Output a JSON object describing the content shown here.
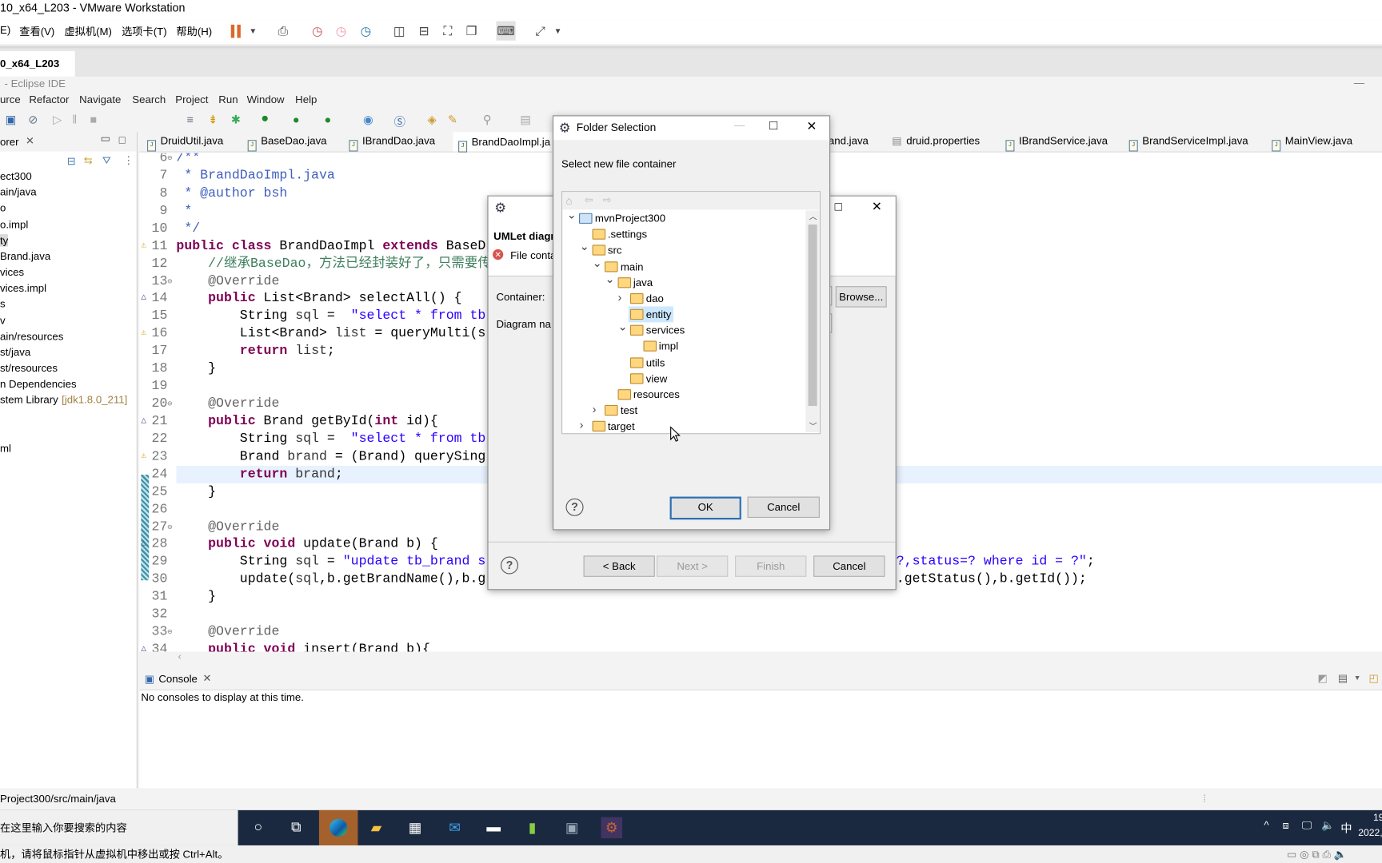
{
  "vmware": {
    "title": "10_x64_L203 - VMware Workstation",
    "menu": [
      "E)",
      "查看(V)",
      "虚拟机(M)",
      "选项卡(T)",
      "帮助(H)"
    ],
    "tab": "0_x64_L203",
    "status": "机，请将鼠标指针从虚拟机中移出或按 Ctrl+Alt。",
    "accent": "#d9692b"
  },
  "eclipse": {
    "title": "- Eclipse IDE",
    "menu": [
      "urce",
      "Refactor",
      "Navigate",
      "Search",
      "Project",
      "Run",
      "Window",
      "Help"
    ],
    "explorer": {
      "title": "orer",
      "items": [
        "ect300",
        "ain/java",
        "o",
        "o.impl",
        "ty",
        "Brand.java",
        "vices",
        "vices.impl",
        "s",
        "v",
        "ain/resources",
        "st/java",
        "st/resources",
        "n Dependencies",
        "stem Library",
        "ml"
      ],
      "jre_suffix": "[jdk1.8.0_211]",
      "selected": "ty"
    },
    "editor_tabs": [
      "DruidUtil.java",
      "BaseDao.java",
      "IBrandDao.java",
      "BrandDaoImpl.ja",
      "and.java",
      "druid.properties",
      "IBrandService.java",
      "BrandServiceImpl.java",
      "MainView.java"
    ],
    "active_tab": "BrandDaoImpl.ja",
    "code": [
      {
        "n": "6",
        "t": [
          [
            "c",
            "/**"
          ]
        ]
      },
      {
        "n": "7",
        "t": [
          [
            "c",
            " * BrandDaoImpl.java"
          ]
        ]
      },
      {
        "n": "8",
        "t": [
          [
            "c",
            " * "
          ],
          [
            "c",
            "@author"
          ],
          [
            "c",
            " bsh"
          ]
        ]
      },
      {
        "n": "9",
        "t": [
          [
            "c",
            " *"
          ]
        ]
      },
      {
        "n": "10",
        "t": [
          [
            "c",
            " */"
          ]
        ]
      },
      {
        "n": "11",
        "t": [
          [
            "k",
            "public"
          ],
          [
            "p",
            " "
          ],
          [
            "k",
            "class"
          ],
          [
            "p",
            " BrandDaoImpl "
          ],
          [
            "k",
            "extends"
          ],
          [
            "p",
            " BaseD"
          ]
        ]
      },
      {
        "n": "12",
        "t": [
          [
            "p",
            "    "
          ],
          [
            "cg",
            "//继承BaseDao，方法已经封装好了，只需要传入s"
          ]
        ]
      },
      {
        "n": "13",
        "t": [
          [
            "p",
            "    "
          ],
          [
            "an",
            "@Override"
          ]
        ]
      },
      {
        "n": "14",
        "t": [
          [
            "p",
            "    "
          ],
          [
            "k",
            "public"
          ],
          [
            "p",
            " List<Brand> selectAll() {"
          ]
        ]
      },
      {
        "n": "15",
        "t": [
          [
            "p",
            "        String "
          ],
          [
            "v",
            "sql"
          ],
          [
            "p",
            " =  "
          ],
          [
            "s",
            "\"select * from tb"
          ]
        ]
      },
      {
        "n": "16",
        "t": [
          [
            "p",
            "        List<Brand> "
          ],
          [
            "v",
            "list"
          ],
          [
            "p",
            " = queryMulti(s"
          ]
        ]
      },
      {
        "n": "17",
        "t": [
          [
            "p",
            "        "
          ],
          [
            "k",
            "return"
          ],
          [
            "p",
            " "
          ],
          [
            "v",
            "list"
          ],
          [
            "p",
            ";"
          ]
        ]
      },
      {
        "n": "18",
        "t": [
          [
            "p",
            "    }"
          ]
        ]
      },
      {
        "n": "19",
        "t": []
      },
      {
        "n": "20",
        "t": [
          [
            "p",
            "    "
          ],
          [
            "an",
            "@Override"
          ]
        ]
      },
      {
        "n": "21",
        "t": [
          [
            "p",
            "    "
          ],
          [
            "k",
            "public"
          ],
          [
            "p",
            " Brand getById("
          ],
          [
            "k",
            "int"
          ],
          [
            "p",
            " id){"
          ]
        ]
      },
      {
        "n": "22",
        "t": [
          [
            "p",
            "        String "
          ],
          [
            "v",
            "sql"
          ],
          [
            "p",
            " =  "
          ],
          [
            "s",
            "\"select * from tb"
          ]
        ]
      },
      {
        "n": "23",
        "t": [
          [
            "p",
            "        Brand "
          ],
          [
            "v",
            "brand"
          ],
          [
            "p",
            " = (Brand) querySing"
          ]
        ]
      },
      {
        "n": "24",
        "t": [
          [
            "p",
            "        "
          ],
          [
            "k",
            "return"
          ],
          [
            "p",
            " "
          ],
          [
            "v",
            "brand"
          ],
          [
            "p",
            ";"
          ]
        ],
        "hl": true
      },
      {
        "n": "25",
        "t": [
          [
            "p",
            "    }"
          ]
        ]
      },
      {
        "n": "26",
        "t": []
      },
      {
        "n": "27",
        "t": [
          [
            "p",
            "    "
          ],
          [
            "an",
            "@Override"
          ]
        ]
      },
      {
        "n": "28",
        "t": [
          [
            "p",
            "    "
          ],
          [
            "k",
            "public"
          ],
          [
            "p",
            " "
          ],
          [
            "k",
            "void"
          ],
          [
            "p",
            " update(Brand b) {"
          ]
        ]
      },
      {
        "n": "29",
        "t": [
          [
            "p",
            "        String "
          ],
          [
            "v",
            "sql"
          ],
          [
            "p",
            " = "
          ],
          [
            "s",
            "\"update tb_brand s"
          ]
        ],
        "tail": [
          [
            "s",
            "?,status=? where id = ?\""
          ],
          [
            "p",
            ";"
          ]
        ]
      },
      {
        "n": "30",
        "t": [
          [
            "p",
            "        update("
          ],
          [
            "v",
            "sql"
          ],
          [
            "p",
            ",b.getBrandName(),b.g"
          ]
        ],
        "tail": [
          [
            "p",
            ".getStatus(),b.getId());"
          ]
        ]
      },
      {
        "n": "31",
        "t": [
          [
            "p",
            "    }"
          ]
        ]
      },
      {
        "n": "32",
        "t": []
      },
      {
        "n": "33",
        "t": [
          [
            "p",
            "    "
          ],
          [
            "an",
            "@Override"
          ]
        ]
      },
      {
        "n": "34",
        "t": [
          [
            "p",
            "    "
          ],
          [
            "k",
            "public"
          ],
          [
            "p",
            " "
          ],
          [
            "k",
            "void"
          ],
          [
            "p",
            " insert(Brand b){"
          ]
        ]
      }
    ],
    "console": {
      "tab": "Console",
      "message": "No consoles to display at this time."
    },
    "status_path": "Project300/src/main/java"
  },
  "umlet_dialog": {
    "title": "UMLet diagr",
    "error": "File conta",
    "container_label": "Container:",
    "browse": "Browse...",
    "diagram_label": "Diagram na",
    "back": "< Back",
    "next": "Next >",
    "finish": "Finish",
    "cancel": "Cancel"
  },
  "folder_dialog": {
    "title": "Folder Selection",
    "prompt": "Select new file container",
    "tree": [
      {
        "label": "mvnProject300",
        "level": 0,
        "chevron": "expanded",
        "project": true
      },
      {
        "label": ".settings",
        "level": 1,
        "chevron": "none"
      },
      {
        "label": "src",
        "level": 1,
        "chevron": "expanded"
      },
      {
        "label": "main",
        "level": 2,
        "chevron": "expanded"
      },
      {
        "label": "java",
        "level": 3,
        "chevron": "expanded"
      },
      {
        "label": "dao",
        "level": 4,
        "chevron": "collapsed"
      },
      {
        "label": "entity",
        "level": 4,
        "chevron": "none",
        "selected": true
      },
      {
        "label": "services",
        "level": 4,
        "chevron": "expanded"
      },
      {
        "label": "impl",
        "level": 5,
        "chevron": "none"
      },
      {
        "label": "utils",
        "level": 4,
        "chevron": "none"
      },
      {
        "label": "view",
        "level": 4,
        "chevron": "none"
      },
      {
        "label": "resources",
        "level": 3,
        "chevron": "none"
      },
      {
        "label": "test",
        "level": 2,
        "chevron": "collapsed"
      },
      {
        "label": "target",
        "level": 1,
        "chevron": "collapsed"
      }
    ],
    "ok": "OK",
    "cancel": "Cancel"
  },
  "taskbar": {
    "search_placeholder": "在这里输入你要搜索的内容",
    "ime": "中",
    "time": "19",
    "date": "2022,"
  }
}
